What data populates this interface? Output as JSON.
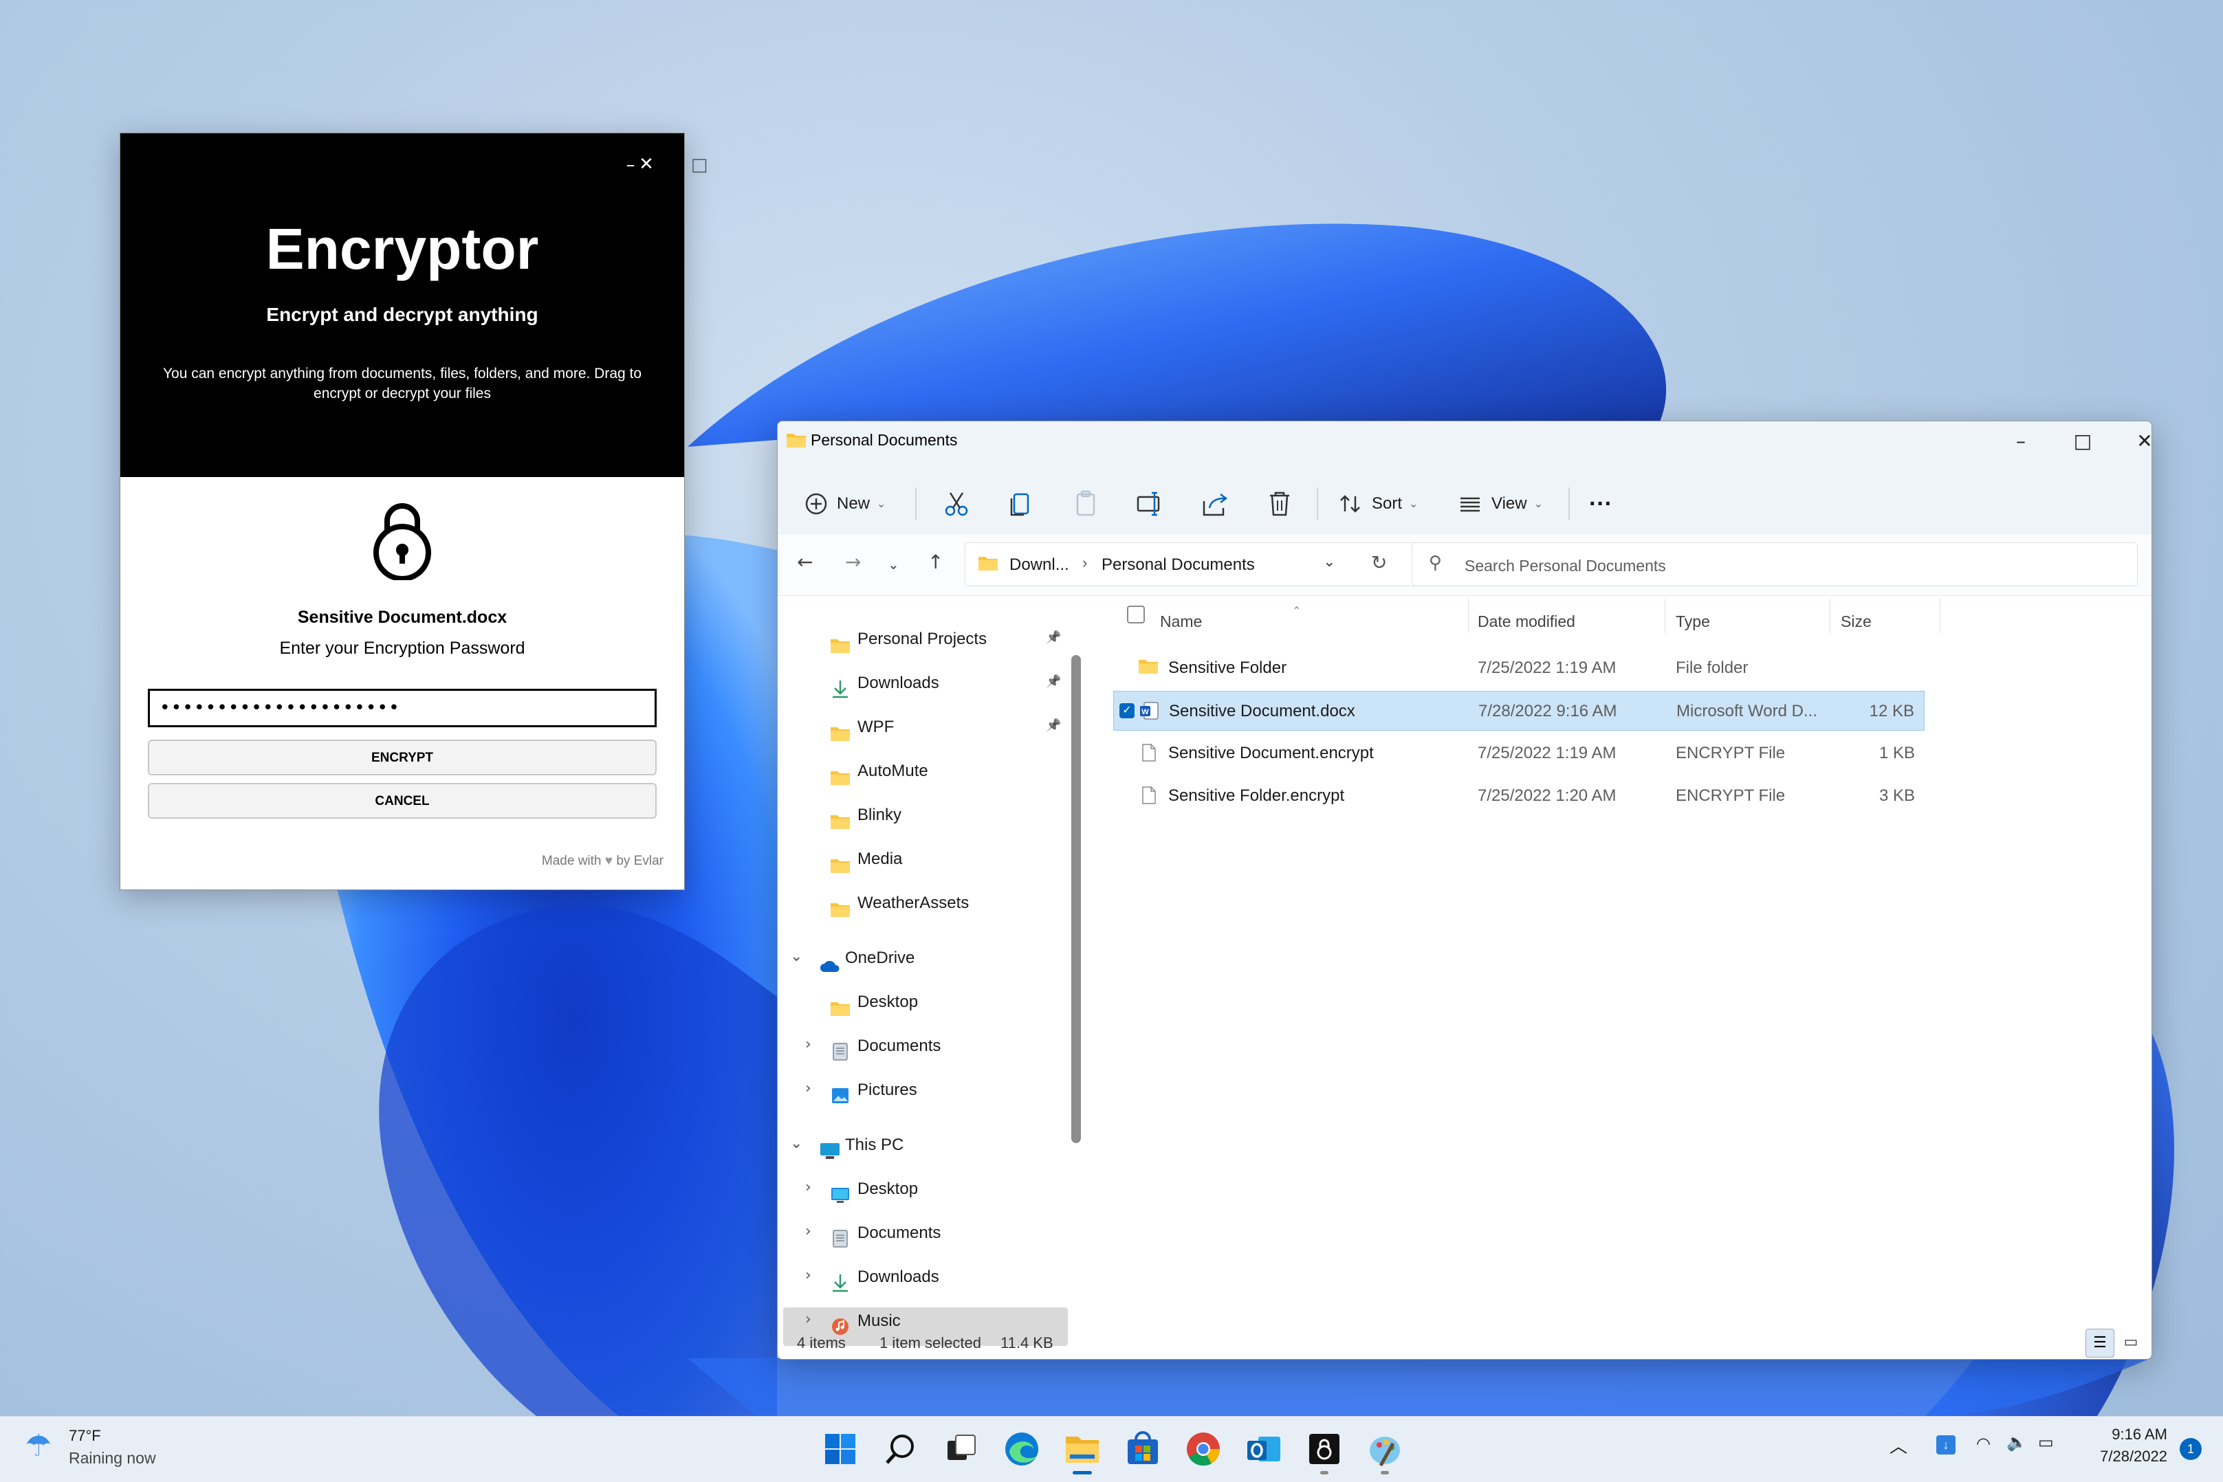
{
  "encryptor": {
    "title": "Encryptor",
    "subtitle": "Encrypt and decrypt anything",
    "description": "You can encrypt anything from documents, files, folders, and more. Drag to encrypt or decrypt your files",
    "file_name": "Sensitive Document.docx",
    "prompt": "Enter your Encryption Password",
    "password_value": "•••••••••••••••••••••",
    "encrypt_label": "ENCRYPT",
    "cancel_label": "CANCEL",
    "footer_made": "Made with",
    "footer_by": "by Evlar",
    "minimize": "–",
    "maximize": "□",
    "close": "✕"
  },
  "explorer": {
    "title": "Personal Documents",
    "toolbar": {
      "new_label": "New",
      "sort_label": "Sort",
      "view_label": "View",
      "more": "···"
    },
    "breadcrumb": [
      "Downl...",
      "Personal Documents"
    ],
    "search_placeholder": "Search Personal Documents",
    "nav": {
      "quick_access": [
        {
          "label": "Personal Projects",
          "pinned": true
        },
        {
          "label": "Downloads",
          "pinned": true
        },
        {
          "label": "WPF",
          "pinned": true
        },
        {
          "label": "AutoMute"
        },
        {
          "label": "Blinky"
        },
        {
          "label": "Media"
        },
        {
          "label": "WeatherAssets"
        }
      ],
      "onedrive": {
        "label": "OneDrive",
        "children": [
          "Desktop",
          "Documents",
          "Pictures"
        ]
      },
      "this_pc": {
        "label": "This PC",
        "children": [
          "Desktop",
          "Documents",
          "Downloads",
          "Music"
        ]
      }
    },
    "columns": {
      "name": "Name",
      "date": "Date modified",
      "type": "Type",
      "size": "Size"
    },
    "files": [
      {
        "name": "Sensitive Folder",
        "date": "7/25/2022 1:19 AM",
        "type": "File folder",
        "size": "",
        "icon": "folder-icon",
        "selected": false
      },
      {
        "name": "Sensitive Document.docx",
        "date": "7/28/2022 9:16 AM",
        "type": "Microsoft Word D...",
        "size": "12 KB",
        "icon": "word-icon",
        "selected": true
      },
      {
        "name": "Sensitive Document.encrypt",
        "date": "7/25/2022 1:19 AM",
        "type": "ENCRYPT File",
        "size": "1 KB",
        "icon": "file-icon",
        "selected": false
      },
      {
        "name": "Sensitive Folder.encrypt",
        "date": "7/25/2022 1:20 AM",
        "type": "ENCRYPT File",
        "size": "3 KB",
        "icon": "file-icon",
        "selected": false
      }
    ],
    "status": {
      "items": "4 items",
      "selected": "1 item selected",
      "size": "11.4 KB"
    }
  },
  "taskbar": {
    "weather_temp": "77°F",
    "weather_text": "Raining now",
    "time": "9:16 AM",
    "date": "7/28/2022",
    "notification_count": "1",
    "apps": [
      "start-icon",
      "search-icon",
      "task-view-icon",
      "edge-icon",
      "file-explorer-icon",
      "store-icon",
      "chrome-icon",
      "outlook-icon",
      "encryptor-icon",
      "paint-icon"
    ]
  },
  "colors": {
    "accent": "#0067c0",
    "selection": "#cce4f7",
    "folder": "#f8c541"
  }
}
